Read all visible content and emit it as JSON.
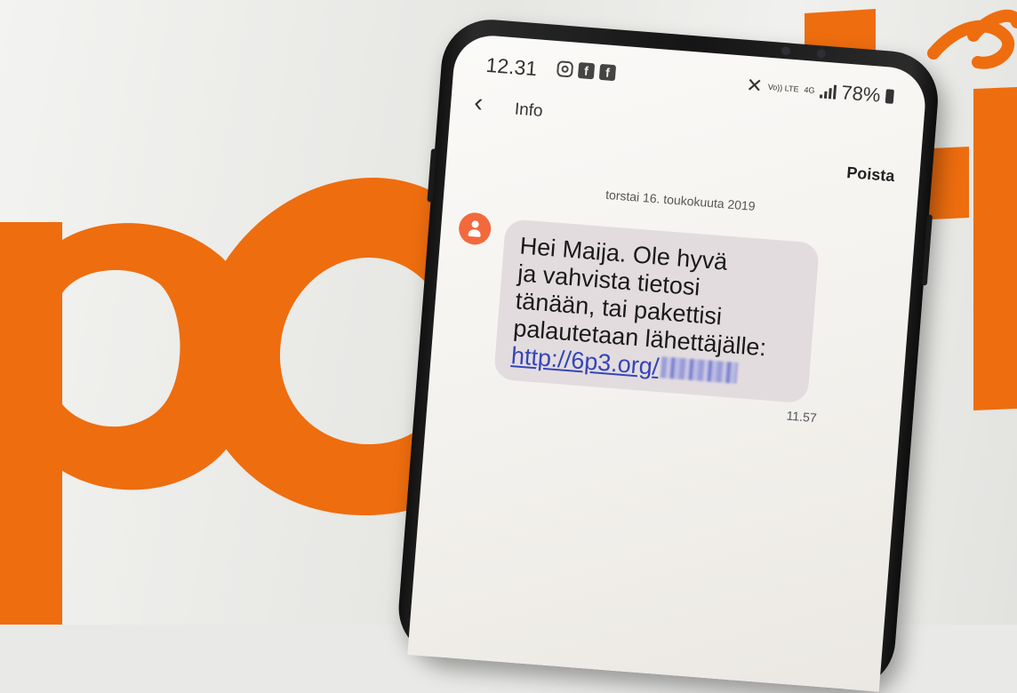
{
  "scene": {
    "background_color": "#e9e9e7",
    "logo_color": "#ee6d0f",
    "phone_color": "#161616"
  },
  "status_bar": {
    "time": "12.31",
    "left_icons": [
      "instagram-icon",
      "facebook-icon",
      "facebook-icon"
    ],
    "facebook_glyph": "f",
    "volte": "Vo)) LTE",
    "network": "4G",
    "battery": "78%"
  },
  "conversation": {
    "contact_name": "Info",
    "delete_label": "Poista",
    "date": "torstai 16. toukokuuta 2019",
    "avatar_color": "#f26a3c",
    "bubble_color": "#e3dcdf",
    "message_lines": [
      "Hei Maija. Ole hyvä",
      "ja vahvista tietosi",
      "tänään, tai pakettisi",
      "palautetaan lähettäjälle:"
    ],
    "link_visible": "http://6p3.org/",
    "link_color": "#3346b8",
    "time": "11.57"
  }
}
